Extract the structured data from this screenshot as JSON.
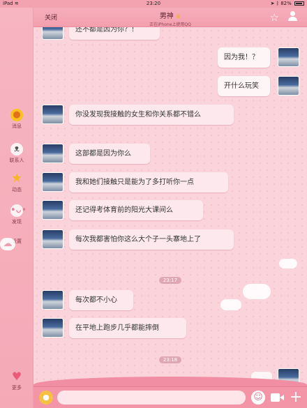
{
  "status_bar": {
    "device": "iPad",
    "wifi_icon": "wifi-icon",
    "time": "23:20",
    "location_icon": "location-arrow-icon",
    "bluetooth_icon": "bluetooth-icon",
    "battery": "82%"
  },
  "header": {
    "close_label": "关闭",
    "title": "男神",
    "title_badge_icon": "crown-icon",
    "subtitle": "正在iPhone上使用QQ",
    "star_icon": "star-icon",
    "profile_icon": "person-icon"
  },
  "sidebar": {
    "items": [
      {
        "label": "消息",
        "icon": "duck-icon"
      },
      {
        "label": "联系人",
        "icon": "cat-face-icon"
      },
      {
        "label": "动态",
        "icon": "star-icon"
      },
      {
        "label": "发现",
        "icon": "bear-face-icon"
      },
      {
        "label": "设置",
        "icon": "cloud-icon"
      }
    ],
    "more_label": "更多",
    "more_icon": "heart-icon"
  },
  "messages": [
    {
      "from": "other",
      "text": "还不都是因为你？！"
    },
    {
      "from": "me",
      "text": "因为我！？"
    },
    {
      "from": "me",
      "text": "开什么玩笑"
    },
    {
      "from": "other",
      "text": "你没发现我接触的女生和你关系都不错么"
    },
    {
      "from": "other",
      "text": "这部都是因为你么"
    },
    {
      "from": "other",
      "text": "我和她们接触只是能为了多打听你一点"
    },
    {
      "from": "other",
      "text": "还记得考体育前的阳光大课间么"
    },
    {
      "from": "other",
      "text": "每次我都害怕你这么大个子一头寨地上了"
    },
    {
      "from": "other",
      "text": "每次都不小心"
    },
    {
      "from": "other",
      "text": "在平地上跑步几乎都能摔倒"
    }
  ],
  "timestamps": [
    "23:17",
    "23:18"
  ],
  "input_bar": {
    "mic_icon": "microphone-icon",
    "input_value": "",
    "input_placeholder": "",
    "emoji_icon": "smiley-icon",
    "video_icon": "video-camera-icon",
    "plus_icon": "plus-icon"
  },
  "colors": {
    "theme_pink": "#f39fae",
    "bubble_pink": "#fde9ed",
    "chat_background": "#fbd3db"
  }
}
